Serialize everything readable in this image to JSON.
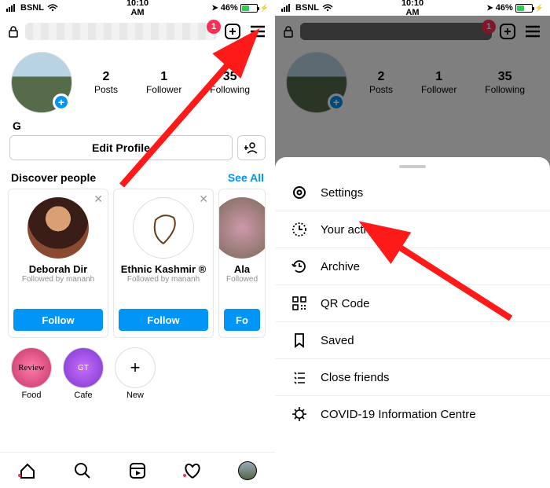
{
  "statusbar": {
    "carrier": "BSNL",
    "time": "10:10 AM",
    "battery_percent": "46%",
    "battery_fill_width": "46%"
  },
  "topbar": {
    "notification_badge": "1"
  },
  "profile": {
    "stats": {
      "posts_num": "2",
      "posts_lbl": "Posts",
      "followers_num": "1",
      "followers_lbl": "Follower",
      "following_num": "35",
      "following_lbl": "Following"
    },
    "display_name": "G",
    "edit_label": "Edit Profile"
  },
  "discover": {
    "title": "Discover people",
    "see_all": "See All",
    "cards": [
      {
        "name": "Deborah Dir",
        "sub": "Followed by mananh",
        "btn": "Follow"
      },
      {
        "name": "Ethnic Kashmir ®",
        "sub": "Followed by mananh",
        "btn": "Follow"
      },
      {
        "name": "Ala",
        "sub": "Followed",
        "btn": "Fo"
      }
    ]
  },
  "stories": [
    {
      "label": "Food"
    },
    {
      "label": "Cafe"
    },
    {
      "label": "New"
    }
  ],
  "menu": {
    "items": [
      {
        "label": "Settings"
      },
      {
        "label": "Your activity"
      },
      {
        "label": "Archive"
      },
      {
        "label": "QR Code"
      },
      {
        "label": "Saved"
      },
      {
        "label": "Close friends"
      },
      {
        "label": "COVID-19 Information Centre"
      }
    ]
  }
}
